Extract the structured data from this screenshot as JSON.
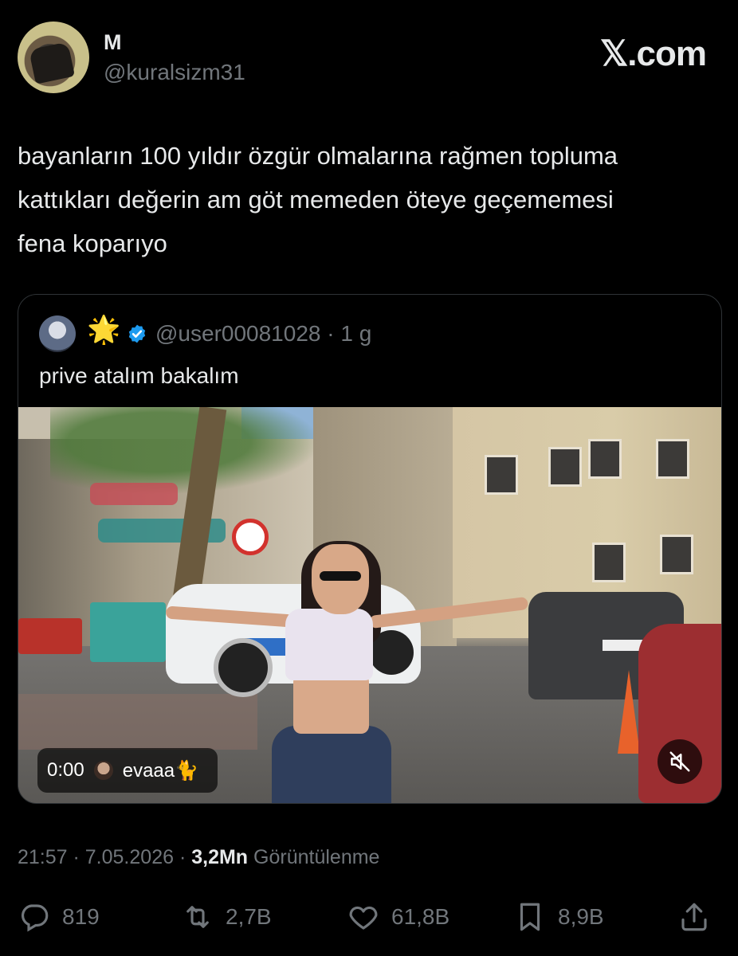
{
  "header": {
    "display_name": "M",
    "handle": "@kuralsizm31",
    "brand": "𝕏.com"
  },
  "tweet": {
    "text_lines": [
      "bayanların 100 yıldır özgür olmalarına rağmen topluma",
      "kattıkları değerin am göt memeden öteye geçememesi",
      "fena koparıyo"
    ]
  },
  "quote": {
    "handle_time": "@user00081028 · 1 g",
    "text": "prive atalım bakalım",
    "video": {
      "time": "0:00",
      "user": "evaaa🐈"
    }
  },
  "meta": {
    "time_date": "21:57 · 7.05.2026 · ",
    "views": "3,2Mn",
    "views_label": " Görüntülenme"
  },
  "actions": {
    "replies": "819",
    "reposts": "2,7B",
    "likes": "61,8B",
    "bookmarks": "8,9B"
  },
  "colors": {
    "background": "#000000",
    "text": "#e7e9ea",
    "muted": "#71767b",
    "verified": "#1d9bf0",
    "border": "#2f3336"
  }
}
